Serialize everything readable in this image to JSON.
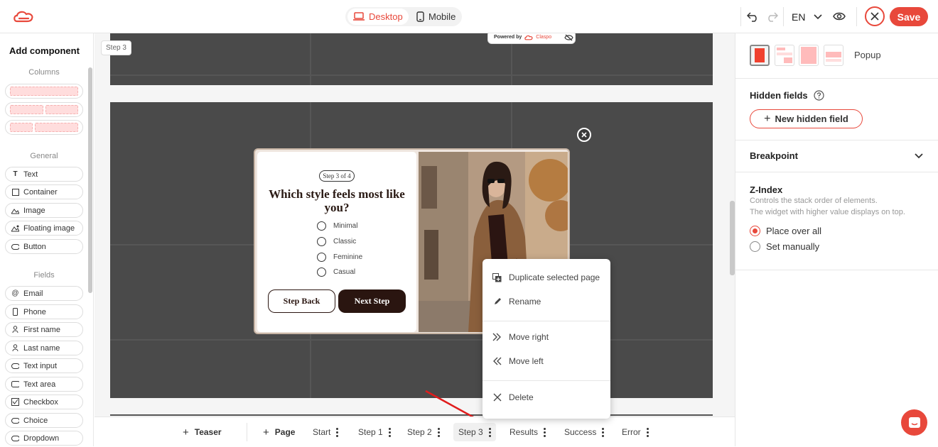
{
  "colors": {
    "accent": "#e8483b",
    "canvas": "#4a4a4a",
    "popup_dark": "#2a1510"
  },
  "top": {
    "logo_icon": "claspo-logo-icon",
    "devices": [
      {
        "label": "Desktop",
        "icon": "desktop-icon",
        "active": true
      },
      {
        "label": "Mobile",
        "icon": "mobile-icon",
        "active": false
      }
    ],
    "language": "EN",
    "save_label": "Save"
  },
  "left": {
    "title": "Add component",
    "columns_label": "Columns",
    "general_label": "General",
    "fields_label": "Fields",
    "general": [
      "Text",
      "Container",
      "Image",
      "Floating image",
      "Button"
    ],
    "fields": [
      "Email",
      "Phone",
      "First name",
      "Last name",
      "Text input",
      "Text area",
      "Checkbox",
      "Choice",
      "Dropdown"
    ]
  },
  "canvas": {
    "step_tag": "Step 3",
    "powered_by": "Powered by",
    "powered_brand": "Claspo"
  },
  "popup": {
    "badge": "Step 3 of 4",
    "title": "Which style feels most like you?",
    "options": [
      "Minimal",
      "Classic",
      "Feminine",
      "Casual"
    ],
    "back_label": "Step Back",
    "next_label": "Next Step"
  },
  "context_menu": {
    "items": [
      {
        "label": "Duplicate selected page",
        "icon": "duplicate-icon"
      },
      {
        "label": "Rename",
        "icon": "pencil-icon"
      },
      {
        "label": "Move right",
        "icon": "double-chevron-right-icon"
      },
      {
        "label": "Move left",
        "icon": "double-chevron-left-icon"
      },
      {
        "label": "Delete",
        "icon": "close-icon"
      }
    ]
  },
  "bottom": {
    "teaser_label": "Teaser",
    "page_label": "Page",
    "tabs": [
      "Start",
      "Step 1",
      "Step 2",
      "Step 3",
      "Results",
      "Success",
      "Error"
    ],
    "active_tab": "Step 3"
  },
  "right": {
    "layout_label": "Popup",
    "hidden_fields_title": "Hidden fields",
    "new_hidden_field": "New hidden field",
    "breakpoint_title": "Breakpoint",
    "zindex_title": "Z-Index",
    "zindex_desc1": "Controls the stack order of elements.",
    "zindex_desc2": "The widget with higher value displays on top.",
    "zindex_options": [
      "Place over all",
      "Set manually"
    ],
    "zindex_selected": "Place over all"
  }
}
